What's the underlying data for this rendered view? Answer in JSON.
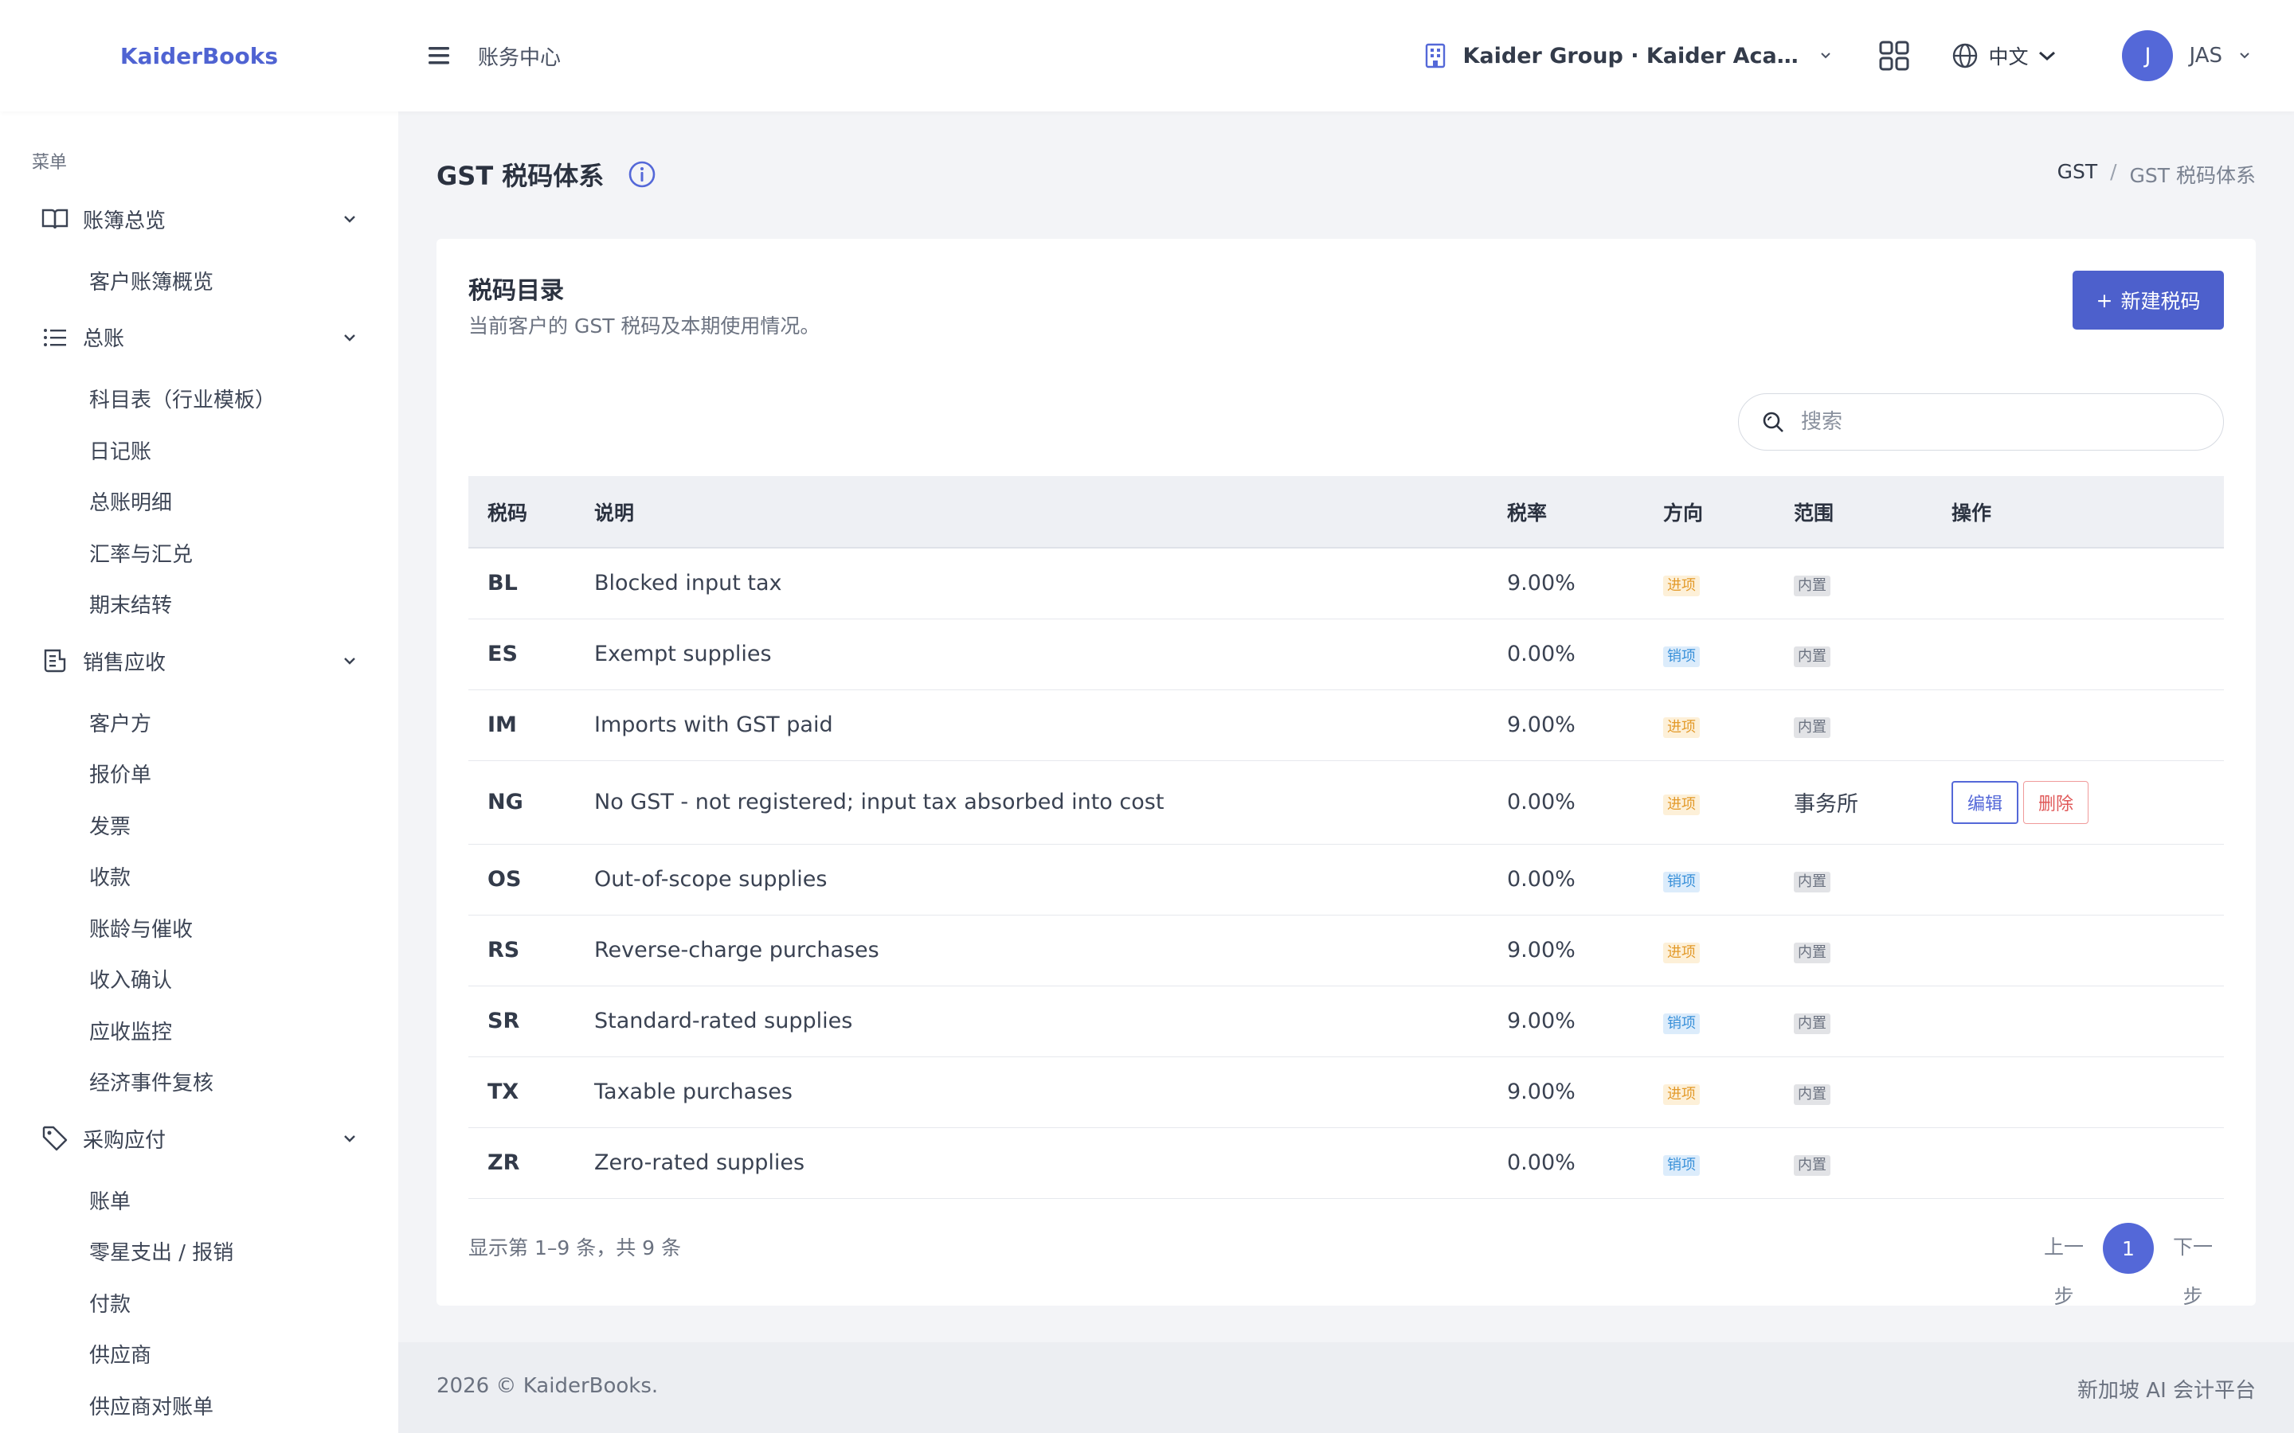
{
  "header": {
    "brand": "KaiderBooks",
    "section": "账务中心",
    "org": "Kaider Group · Kaider Academy ...",
    "language": "中文",
    "user_initial": "J",
    "user_name": "JAS"
  },
  "sidebar": {
    "menu_title": "菜单",
    "groups": [
      {
        "label": "账簿总览",
        "icon": "book-icon",
        "items": [
          "客户账簿概览"
        ]
      },
      {
        "label": "总账",
        "icon": "list-icon",
        "items": [
          "科目表（行业模板）",
          "日记账",
          "总账明细",
          "汇率与汇兑",
          "期末结转"
        ]
      },
      {
        "label": "销售应收",
        "icon": "receipt-icon",
        "items": [
          "客户方",
          "报价单",
          "发票",
          "收款",
          "账龄与催收",
          "收入确认",
          "应收监控",
          "经济事件复核"
        ]
      },
      {
        "label": "采购应付",
        "icon": "tag-icon",
        "items": [
          "账单",
          "零星支出 / 报销",
          "付款",
          "供应商",
          "供应商对账单"
        ]
      }
    ]
  },
  "page": {
    "title": "GST 税码体系",
    "breadcrumb": [
      "GST",
      "GST 税码体系"
    ]
  },
  "card": {
    "title": "税码目录",
    "subtitle": "当前客户的 GST 税码及本期使用情况。",
    "new_button": "新建税码",
    "search_placeholder": "搜索"
  },
  "table": {
    "headers": [
      "税码",
      "说明",
      "税率",
      "方向",
      "范围",
      "操作"
    ],
    "rows": [
      {
        "code": "BL",
        "desc": "Blocked input tax",
        "rate": "9.00%",
        "dir": "进项",
        "dir_type": "in",
        "scope": "内置",
        "scope_type": "builtin"
      },
      {
        "code": "ES",
        "desc": "Exempt supplies",
        "rate": "0.00%",
        "dir": "销项",
        "dir_type": "out",
        "scope": "内置",
        "scope_type": "builtin"
      },
      {
        "code": "IM",
        "desc": "Imports with GST paid",
        "rate": "9.00%",
        "dir": "进项",
        "dir_type": "in",
        "scope": "内置",
        "scope_type": "builtin"
      },
      {
        "code": "NG",
        "desc": "No GST - not registered; input tax absorbed into cost",
        "rate": "0.00%",
        "dir": "进项",
        "dir_type": "in",
        "scope": "事务所",
        "scope_type": "firm",
        "edit": "编辑",
        "delete": "删除"
      },
      {
        "code": "OS",
        "desc": "Out-of-scope supplies",
        "rate": "0.00%",
        "dir": "销项",
        "dir_type": "out",
        "scope": "内置",
        "scope_type": "builtin"
      },
      {
        "code": "RS",
        "desc": "Reverse-charge purchases",
        "rate": "9.00%",
        "dir": "进项",
        "dir_type": "in",
        "scope": "内置",
        "scope_type": "builtin"
      },
      {
        "code": "SR",
        "desc": "Standard-rated supplies",
        "rate": "9.00%",
        "dir": "销项",
        "dir_type": "out",
        "scope": "内置",
        "scope_type": "builtin"
      },
      {
        "code": "TX",
        "desc": "Taxable purchases",
        "rate": "9.00%",
        "dir": "进项",
        "dir_type": "in",
        "scope": "内置",
        "scope_type": "builtin"
      },
      {
        "code": "ZR",
        "desc": "Zero-rated supplies",
        "rate": "0.00%",
        "dir": "销项",
        "dir_type": "out",
        "scope": "内置",
        "scope_type": "builtin"
      }
    ]
  },
  "pagination": {
    "summary": "显示第 1–9 条，共 9 条",
    "prev": "上一步",
    "current": "1",
    "next": "下一步"
  },
  "footer": {
    "left": "2026 © KaiderBooks.",
    "right": "新加坡 AI 会计平台"
  },
  "colors": {
    "accent": "#5468d8",
    "tag_in": "#e39a2a",
    "tag_out": "#3a91d9",
    "danger": "#e05858"
  }
}
